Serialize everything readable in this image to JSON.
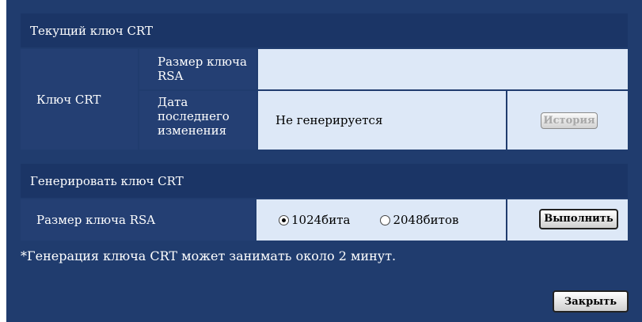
{
  "current_section": {
    "title": "Текущий ключ CRT",
    "row_label": "Ключ CRT",
    "rsa_size_label": "Размер ключа RSA",
    "rsa_size_value": "",
    "last_modified_label": "Дата последнего изменения",
    "last_modified_value": "Не генерируется",
    "history_button": "История"
  },
  "generate_section": {
    "title": "Генерировать ключ CRT",
    "rsa_size_label": "Размер ключа RSA",
    "options": [
      {
        "label": "1024бита",
        "selected": true
      },
      {
        "label": "2048битов",
        "selected": false
      }
    ],
    "execute_button": "Выполнить"
  },
  "note": "*Генерация ключа CRT может занимать около 2 минут.",
  "close_button": "Закрыть"
}
